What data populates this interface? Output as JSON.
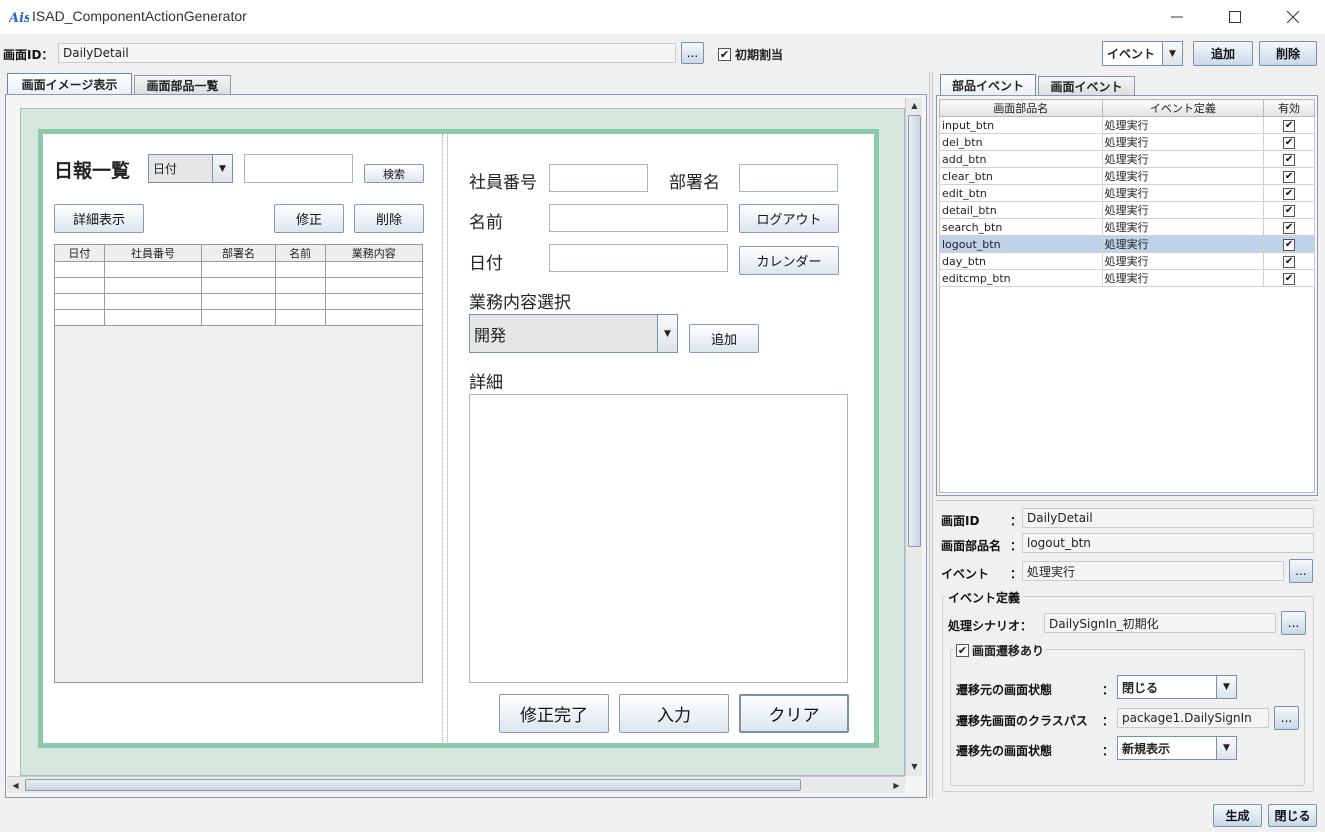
{
  "window": {
    "title": "ISAD_ComponentActionGenerator",
    "app_icon": "ais-logo-icon",
    "minimize": "—",
    "maximize": "☐",
    "close": "✕"
  },
  "toolbar": {
    "screen_id_label": "画面ID：",
    "screen_id_value": "DailyDetail",
    "browse_label": "...",
    "init_assign_checked": true,
    "init_assign_label": "初期割当",
    "event_combo_value": "イベント",
    "add_label": "追加",
    "delete_label": "削除"
  },
  "left_tabs": [
    "画面イメージ表示",
    "画面部品一覧"
  ],
  "preview": {
    "list_title": "日報一覧",
    "search_combo": "日付",
    "search_button": "検索",
    "detail_button": "詳細表示",
    "edit_button": "修正",
    "delete_button": "削除",
    "list_columns": [
      "日付",
      "社員番号",
      "部署名",
      "名前",
      "業務内容"
    ],
    "emp_no_label": "社員番号",
    "dept_label": "部署名",
    "name_label": "名前",
    "logout_button": "ログアウト",
    "date_label": "日付",
    "calendar_button": "カレンダー",
    "work_select_label": "業務内容選択",
    "work_combo": "開発",
    "add_button": "追加",
    "detail_label": "詳細",
    "edit_done_button": "修正完了",
    "input_button": "入力",
    "clear_button": "クリア"
  },
  "right_tabs": [
    "部品イベント",
    "画面イベント"
  ],
  "events_table": {
    "columns": [
      "画面部品名",
      "イベント定義",
      "有効"
    ],
    "rows": [
      {
        "name": "input_btn",
        "event": "処理実行",
        "enabled": "✔"
      },
      {
        "name": "del_btn",
        "event": "処理実行",
        "enabled": "✔"
      },
      {
        "name": "add_btn",
        "event": "処理実行",
        "enabled": "✔"
      },
      {
        "name": "clear_btn",
        "event": "処理実行",
        "enabled": "✔"
      },
      {
        "name": "edit_btn",
        "event": "処理実行",
        "enabled": "✔"
      },
      {
        "name": "detail_btn",
        "event": "処理実行",
        "enabled": "✔"
      },
      {
        "name": "search_btn",
        "event": "処理実行",
        "enabled": "✔"
      },
      {
        "name": "logout_btn",
        "event": "処理実行",
        "enabled": "✔"
      },
      {
        "name": "day_btn",
        "event": "処理実行",
        "enabled": "✔"
      },
      {
        "name": "editcmp_btn",
        "event": "処理実行",
        "enabled": "✔"
      }
    ],
    "selected_row": "logout_btn"
  },
  "detail_panel": {
    "screen_id_label": "画面ID",
    "screen_id_value": "DailyDetail",
    "component_label": "画面部品名",
    "component_value": "logout_btn",
    "event_label": "イベント",
    "event_value": "処理実行",
    "colon": "：",
    "browse_label": "...",
    "event_def_group": "イベント定義",
    "scenario_label": "処理シナリオ：",
    "scenario_value": "DailySignIn_初期化",
    "transition_checked": true,
    "transition_label": "画面遷移あり",
    "src_state_label": "遷移元の画面状態",
    "src_state_value": "閉じる",
    "dest_class_label": "遷移先画面のクラスパス",
    "dest_class_value": "package1.DailySignIn",
    "dest_state_label": "遷移先の画面状態",
    "dest_state_value": "新規表示"
  },
  "footer": {
    "generate_label": "生成",
    "close_label": "閉じる"
  },
  "colors": {
    "preview_bg": "#d5e7dc",
    "preview_frame": "#8cc9a8",
    "selected_row": "#bfd3e8"
  }
}
